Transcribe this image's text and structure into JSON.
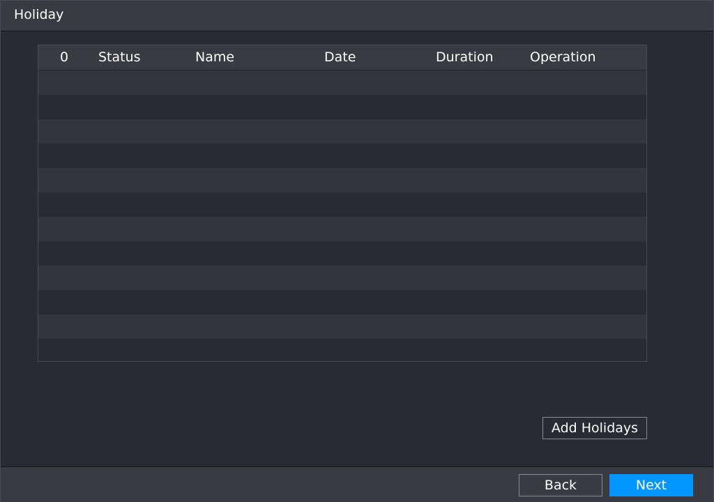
{
  "window": {
    "title": "Holiday"
  },
  "table": {
    "columns": [
      "0",
      "Status",
      "Name",
      "Date",
      "Duration",
      "Operation"
    ],
    "rows": []
  },
  "buttons": {
    "add_holidays": "Add Holidays",
    "back": "Back",
    "next": "Next"
  },
  "colors": {
    "background": "#292a33",
    "header_bar": "#393a42",
    "row_alt": "#33343d",
    "accent": "#0095ff"
  }
}
